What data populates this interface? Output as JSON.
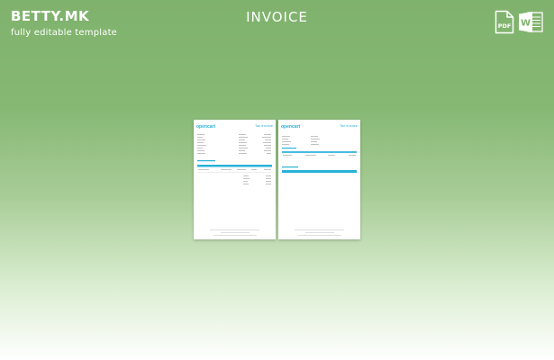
{
  "brand": {
    "name": "BETTY.MK",
    "tagline": "fully editable template"
  },
  "title": "INVOICE",
  "downloads": [
    {
      "label": "PDF",
      "icon": "pdf-file-icon"
    },
    {
      "label": "W",
      "icon": "word-file-icon"
    }
  ],
  "preview": {
    "logo_text": "opencart",
    "page_heading": "Tax Invoice"
  },
  "colors": {
    "accent": "#29b2d8",
    "background_top": "#7fb26c",
    "background_bottom": "#ffffff"
  }
}
